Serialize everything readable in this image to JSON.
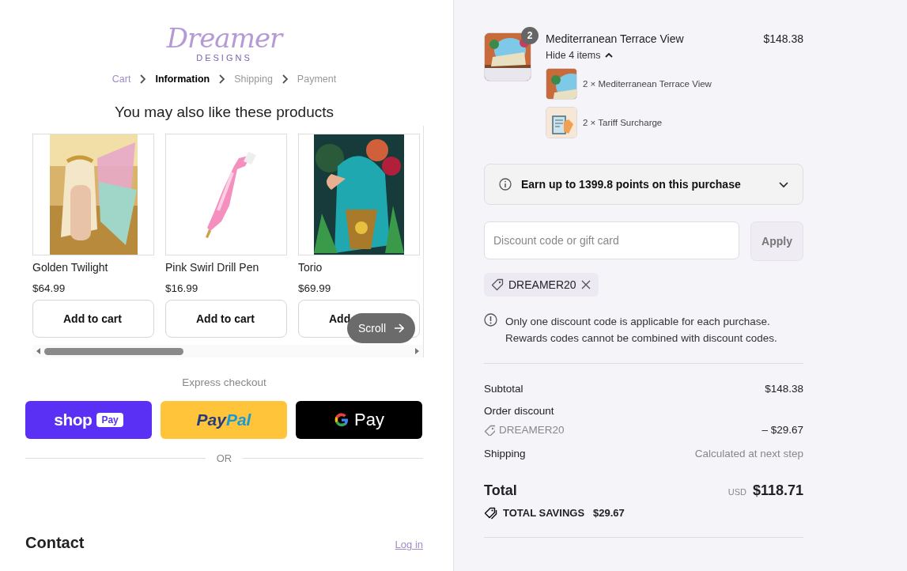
{
  "logo": {
    "wordmark": "Dreamer",
    "tagline": "DESIGNS"
  },
  "breadcrumbs": [
    {
      "label": "Cart",
      "selected": false
    },
    {
      "label": "Information",
      "selected": true
    },
    {
      "label": "Shipping",
      "selected": false
    },
    {
      "label": "Payment",
      "selected": false
    }
  ],
  "recommendations": {
    "title": "You may also like these products",
    "scroll_button": "Scroll",
    "products": [
      {
        "name": "Golden Twilight",
        "price": "$64.99",
        "button": "Add to cart"
      },
      {
        "name": "Pink Swirl Drill Pen",
        "price": "$16.99",
        "button": "Add to cart"
      },
      {
        "name": "Torio",
        "price": "$69.99",
        "button": "Add"
      }
    ]
  },
  "express_checkout": {
    "title": "Express checkout",
    "buttons": [
      {
        "kind": "shop_pay",
        "text": [
          "shop",
          "Pay"
        ]
      },
      {
        "kind": "paypal",
        "text": [
          "Pay",
          "Pal"
        ]
      },
      {
        "kind": "google_pay",
        "text": [
          "Pay"
        ]
      }
    ]
  },
  "divider_label": "OR",
  "contact": {
    "title": "Contact",
    "login_link": "Log in"
  },
  "order": {
    "items": [
      {
        "title": "Mediterranean Terrace View",
        "quantity": "2",
        "price": "$148.38",
        "toggle": "Hide 4 items",
        "expanded": true,
        "components": [
          {
            "label": "2 × Mediterranean Terrace View"
          },
          {
            "label": "2 × Tariff Surcharge"
          }
        ]
      }
    ]
  },
  "rewards": {
    "text": "Earn up to 1399.8 points on this purchase",
    "expanded": false
  },
  "discount": {
    "placeholder": "Discount code or gift card",
    "button": "Apply",
    "button_disabled": true,
    "applied_codes": [
      "DREAMER20"
    ],
    "notice_lines": [
      "Only one discount code is applicable for each purchase.",
      "Rewards codes cannot be combined with discount codes."
    ]
  },
  "summary": {
    "subtotal_label": "Subtotal",
    "subtotal": "$148.38",
    "discount_label": "Order discount",
    "discount_code": "DREAMER20",
    "discount_amount": "– $29.67",
    "shipping_label": "Shipping",
    "shipping": "Calculated at next step",
    "total_label": "Total",
    "currency": "USD",
    "total": "$118.71",
    "savings_label": "TOTAL SAVINGS",
    "savings": "$29.67"
  }
}
